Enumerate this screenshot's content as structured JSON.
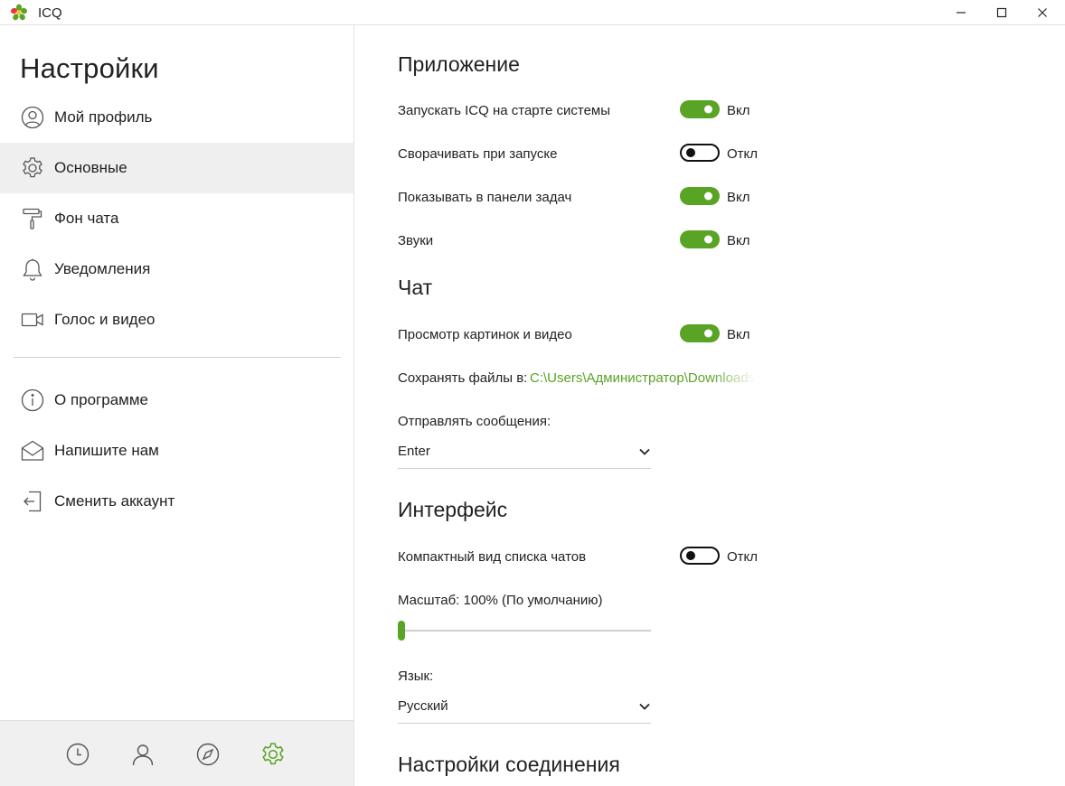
{
  "window": {
    "title": "ICQ",
    "logo_icon": "icq-flower-icon",
    "controls": [
      "minimize-icon",
      "maximize-icon",
      "close-icon"
    ]
  },
  "sidebar": {
    "title": "Настройки",
    "items": [
      {
        "label": "Мой профиль",
        "icon": "user-circle-icon",
        "active": false
      },
      {
        "label": "Основные",
        "icon": "gear-icon",
        "active": true
      },
      {
        "label": "Фон чата",
        "icon": "paint-roller-icon",
        "active": false
      },
      {
        "label": "Уведомления",
        "icon": "bell-icon",
        "active": false
      },
      {
        "label": "Голос и видео",
        "icon": "video-camera-icon",
        "active": false
      }
    ],
    "items2": [
      {
        "label": "О программе",
        "icon": "info-icon"
      },
      {
        "label": "Напишите нам",
        "icon": "envelope-icon"
      },
      {
        "label": "Сменить аккаунт",
        "icon": "sign-out-icon"
      }
    ],
    "bottom_tabs": [
      {
        "icon": "clock-icon",
        "active": false
      },
      {
        "icon": "contacts-icon",
        "active": false
      },
      {
        "icon": "compass-icon",
        "active": false
      },
      {
        "icon": "gear-icon",
        "active": true
      }
    ]
  },
  "main": {
    "app_section": {
      "title": "Приложение",
      "settings": [
        {
          "label": "Запускать ICQ на старте системы",
          "on": true,
          "state": "Вкл"
        },
        {
          "label": "Сворачивать при запуске",
          "on": false,
          "state": "Откл"
        },
        {
          "label": "Показывать в панели задач",
          "on": true,
          "state": "Вкл"
        },
        {
          "label": "Звуки",
          "on": true,
          "state": "Вкл"
        }
      ]
    },
    "chat_section": {
      "title": "Чат",
      "preview": {
        "label": "Просмотр картинок и видео",
        "on": true,
        "state": "Вкл"
      },
      "save_files_label": "Сохранять файлы в:",
      "save_files_path": "C:\\Users\\Администратор\\Downloads",
      "send_label": "Отправлять сообщения:",
      "send_value": "Enter"
    },
    "interface_section": {
      "title": "Интерфейс",
      "compact": {
        "label": "Компактный вид списка чатов",
        "on": false,
        "state": "Откл"
      },
      "scale_label": "Масштаб: 100% (По умолчанию)",
      "scale_percent": 0,
      "language_label": "Язык:",
      "language_value": "Русский"
    },
    "connection_section": {
      "title": "Настройки соединения"
    }
  },
  "colors": {
    "accent": "#59a325",
    "active_item_bg": "#efefef",
    "bottom_bar_bg": "#f0f0f0"
  }
}
